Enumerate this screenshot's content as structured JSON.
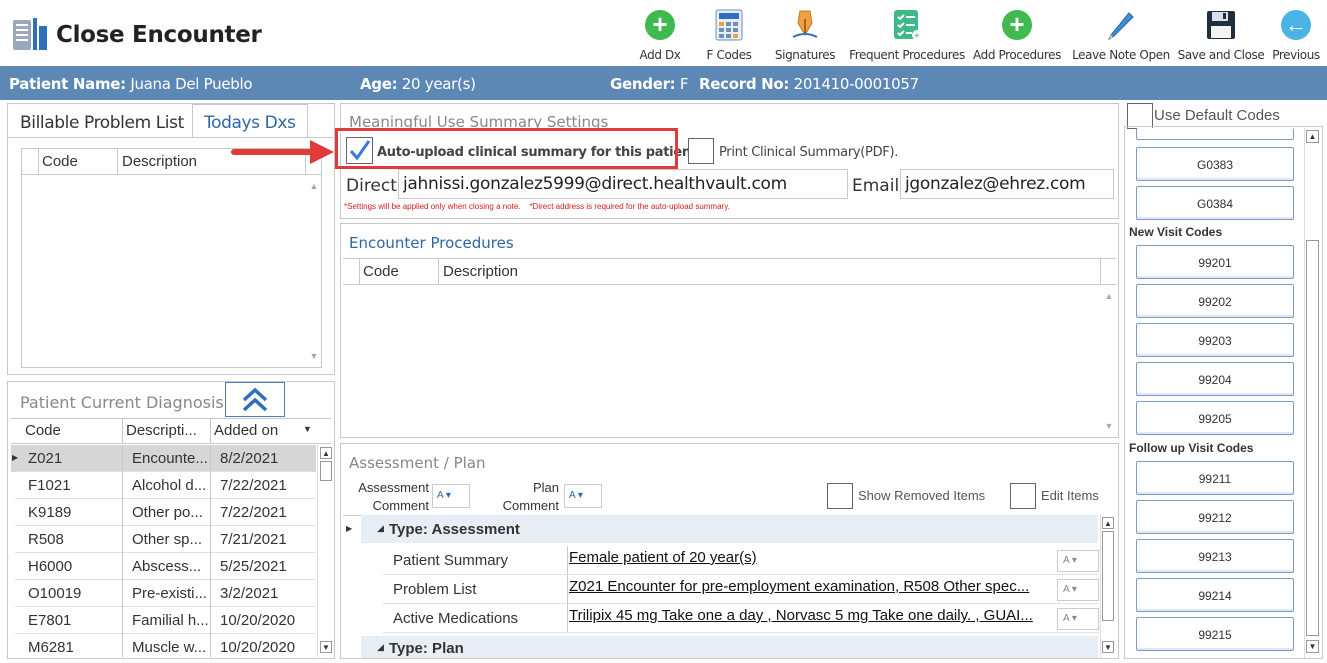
{
  "title": "Close Encounter",
  "toolbar": [
    {
      "label": "Add Dx",
      "icon": "add-circle-icon"
    },
    {
      "label": "F Codes",
      "icon": "calculator-icon"
    },
    {
      "label": "Signatures",
      "icon": "pen-nib-icon"
    },
    {
      "label": "Frequent Procedures",
      "icon": "checklist-icon"
    },
    {
      "label": "Add Procedures",
      "icon": "add-circle-icon"
    },
    {
      "label": "Leave Note Open",
      "icon": "pencil-icon"
    },
    {
      "label": "Save and Close",
      "icon": "floppy-disk-icon"
    },
    {
      "label": "Previous",
      "icon": "back-arrow-icon"
    }
  ],
  "patient": {
    "name_label": "Patient Name:",
    "name": "Juana Del Pueblo",
    "age_label": "Age:",
    "age": "20 year(s)",
    "gender_label": "Gender:",
    "gender": "F",
    "record_label": "Record No:",
    "record": "201410-0001057"
  },
  "left_tabs": {
    "tab1": "Billable Problem List",
    "tab2": "Todays Dxs"
  },
  "billable_grid": {
    "col_code": "Code",
    "col_desc": "Description"
  },
  "current_diag": {
    "title": "Patient Current Diagnosis",
    "col_code": "Code",
    "col_desc": "Descripti...",
    "col_added": "Added on",
    "rows": [
      {
        "code": "Z021",
        "desc": "Encounte...",
        "added": "8/2/2021"
      },
      {
        "code": "F1021",
        "desc": "Alcohol d...",
        "added": "7/22/2021"
      },
      {
        "code": "K9189",
        "desc": "Other po...",
        "added": "7/22/2021"
      },
      {
        "code": "R508",
        "desc": "Other sp...",
        "added": "7/21/2021"
      },
      {
        "code": "H6000",
        "desc": "Abscess...",
        "added": "5/25/2021"
      },
      {
        "code": "O10019",
        "desc": "Pre-existi...",
        "added": "3/2/2021"
      },
      {
        "code": "E7801",
        "desc": "Familial h...",
        "added": "10/20/2020"
      },
      {
        "code": "M6281",
        "desc": "Muscle w...",
        "added": "10/20/2020"
      }
    ]
  },
  "mu": {
    "title": "Meaningful Use Summary Settings",
    "auto_upload": "Auto-upload clinical summary for this patient.",
    "print_summary": "Print Clinical Summary(PDF).",
    "direct_label": "Direct:",
    "direct_value": "jahnissi.gonzalez5999@direct.healthvault.com",
    "email_label": "Email:",
    "email_value": "jgonzalez@ehrez.com",
    "note": "*Settings will be applied only when closing a note.    *Direct address is required for the auto-upload summary."
  },
  "procedures": {
    "title": "Encounter Procedures",
    "col_code": "Code",
    "col_desc": "Description"
  },
  "assessment": {
    "title": "Assessment / Plan",
    "assessment_comment": "Assessment Comment",
    "plan_comment": "Plan Comment",
    "show_removed": "Show Removed Items",
    "edit_items": "Edit Items",
    "group1": "Type: Assessment",
    "rows": [
      {
        "label": "Patient Summary",
        "value": "Female patient of 20 year(s)"
      },
      {
        "label": "Problem List",
        "value": "Z021 Encounter for pre-employment examination, R508 Other spec..."
      },
      {
        "label": "Active Medications",
        "value": "Trilipix 45 mg Take one a day , Norvasc 5 mg Take one daily. , GUAI..."
      }
    ],
    "group2": "Type: Plan"
  },
  "codes": {
    "use_default": "Use Default Codes",
    "top": [
      "G0383",
      "G0384"
    ],
    "new_visit_title": "New Visit Codes",
    "new_visit": [
      "99201",
      "99202",
      "99203",
      "99204",
      "99205"
    ],
    "follow_up_title": "Follow up Visit Codes",
    "follow_up": [
      "99211",
      "99212",
      "99213",
      "99214",
      "99215"
    ]
  },
  "colors": {
    "patient_bar": "#5d87b5",
    "accent_blue": "#2f66a8",
    "highlight_red": "#e03a3a",
    "add_green": "#3fb950"
  }
}
